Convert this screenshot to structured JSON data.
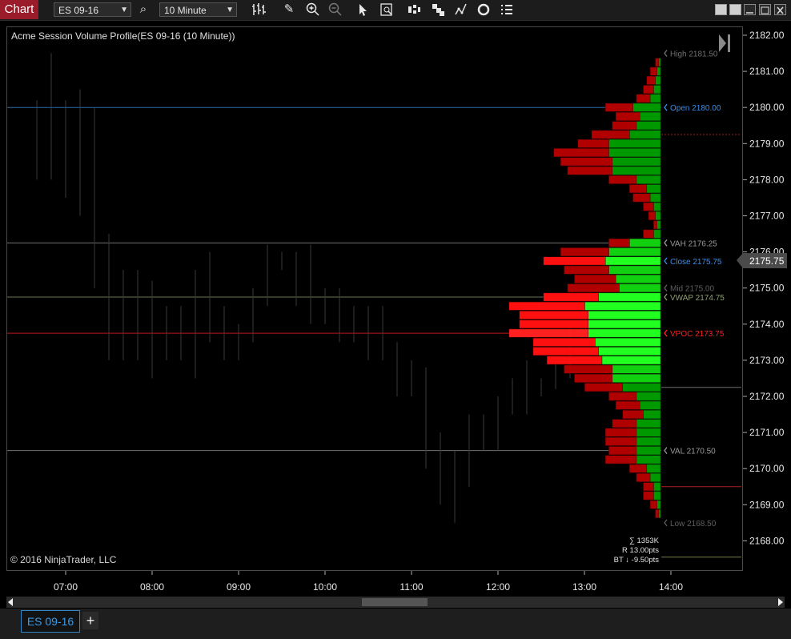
{
  "toolbar": {
    "chart_label": "Chart",
    "instrument": "ES 09-16",
    "interval": "10 Minute"
  },
  "chart": {
    "title": "Acme Session Volume Profile(ES 09-16 (10 Minute))",
    "copyright": "© 2016 NinjaTrader, LLC",
    "stats": [
      "∑ 1353K",
      "R 13.00pts",
      "BT ↓ -9.50pts"
    ],
    "current_price": "2175.75",
    "colors": {
      "bid": "#c00000",
      "ask": "#00c000",
      "poc": "#ff2020",
      "open": "#3a8ee6",
      "accent": "#9a1b2a"
    }
  },
  "chart_data": {
    "type": "volume-profile",
    "y_ticks": [
      "2182.00",
      "2181.00",
      "2180.00",
      "2179.00",
      "2178.00",
      "2177.00",
      "2176.00",
      "2175.00",
      "2174.00",
      "2173.00",
      "2172.00",
      "2171.00",
      "2170.00",
      "2169.00",
      "2168.00"
    ],
    "x_ticks": [
      "07:00",
      "08:00",
      "09:00",
      "10:00",
      "11:00",
      "12:00",
      "13:00",
      "14:00"
    ],
    "ylim": [
      2167.5,
      2182.3
    ],
    "levels": [
      {
        "label": "High 2181.50",
        "price": 2181.5,
        "color": "#6f6f6f"
      },
      {
        "label": "Open 2180.00",
        "price": 2180.0,
        "color": "#3a8ee6"
      },
      {
        "label": "VAH 2176.25",
        "price": 2176.25,
        "color": "#9a9a9a"
      },
      {
        "label": "Close 2175.75",
        "price": 2175.75,
        "color": "#3a8ee6"
      },
      {
        "label": "Mid 2175.00",
        "price": 2175.0,
        "color": "#5f5f5f"
      },
      {
        "label": "VWAP 2174.75",
        "price": 2174.75,
        "color": "#8f9f6f"
      },
      {
        "label": "VPOC 2173.75",
        "price": 2173.75,
        "color": "#ff2020"
      },
      {
        "label": "VAL 2170.50",
        "price": 2170.5,
        "color": "#9a9a9a"
      },
      {
        "label": "Low 2168.50",
        "price": 2168.5,
        "color": "#5f5f5f"
      }
    ],
    "profile": [
      {
        "price": 2181.25,
        "bid": 2,
        "ask": 1
      },
      {
        "price": 2181.0,
        "bid": 4,
        "ask": 2
      },
      {
        "price": 2180.75,
        "bid": 5,
        "ask": 3
      },
      {
        "price": 2180.5,
        "bid": 6,
        "ask": 4
      },
      {
        "price": 2180.25,
        "bid": 8,
        "ask": 6
      },
      {
        "price": 2180.0,
        "bid": 16,
        "ask": 16
      },
      {
        "price": 2179.75,
        "bid": 14,
        "ask": 12
      },
      {
        "price": 2179.5,
        "bid": 14,
        "ask": 14
      },
      {
        "price": 2179.25,
        "bid": 22,
        "ask": 18
      },
      {
        "price": 2179.0,
        "bid": 18,
        "ask": 30
      },
      {
        "price": 2178.75,
        "bid": 32,
        "ask": 30
      },
      {
        "price": 2178.5,
        "bid": 30,
        "ask": 28
      },
      {
        "price": 2178.25,
        "bid": 26,
        "ask": 28
      },
      {
        "price": 2178.0,
        "bid": 16,
        "ask": 14
      },
      {
        "price": 2177.75,
        "bid": 10,
        "ask": 8
      },
      {
        "price": 2177.5,
        "bid": 10,
        "ask": 6
      },
      {
        "price": 2177.25,
        "bid": 6,
        "ask": 4
      },
      {
        "price": 2177.0,
        "bid": 4,
        "ask": 3
      },
      {
        "price": 2176.75,
        "bid": 2,
        "ask": 2
      },
      {
        "price": 2176.5,
        "bid": 6,
        "ask": 4
      },
      {
        "price": 2176.25,
        "bid": 12,
        "ask": 18
      },
      {
        "price": 2176.0,
        "bid": 28,
        "ask": 30
      },
      {
        "price": 2175.75,
        "bid": 36,
        "ask": 32
      },
      {
        "price": 2175.5,
        "bid": 26,
        "ask": 30
      },
      {
        "price": 2175.25,
        "bid": 24,
        "ask": 26
      },
      {
        "price": 2175.0,
        "bid": 30,
        "ask": 24
      },
      {
        "price": 2174.75,
        "bid": 32,
        "ask": 36
      },
      {
        "price": 2174.5,
        "bid": 44,
        "ask": 44
      },
      {
        "price": 2174.25,
        "bid": 40,
        "ask": 42
      },
      {
        "price": 2174.0,
        "bid": 40,
        "ask": 42
      },
      {
        "price": 2173.75,
        "bid": 46,
        "ask": 42
      },
      {
        "price": 2173.5,
        "bid": 36,
        "ask": 38
      },
      {
        "price": 2173.25,
        "bid": 38,
        "ask": 36
      },
      {
        "price": 2173.0,
        "bid": 32,
        "ask": 34
      },
      {
        "price": 2172.75,
        "bid": 28,
        "ask": 28
      },
      {
        "price": 2172.5,
        "bid": 22,
        "ask": 28
      },
      {
        "price": 2172.25,
        "bid": 22,
        "ask": 22
      },
      {
        "price": 2172.0,
        "bid": 16,
        "ask": 14
      },
      {
        "price": 2171.75,
        "bid": 14,
        "ask": 12
      },
      {
        "price": 2171.5,
        "bid": 12,
        "ask": 10
      },
      {
        "price": 2171.25,
        "bid": 14,
        "ask": 14
      },
      {
        "price": 2171.0,
        "bid": 18,
        "ask": 14
      },
      {
        "price": 2170.75,
        "bid": 18,
        "ask": 14
      },
      {
        "price": 2170.5,
        "bid": 16,
        "ask": 14
      },
      {
        "price": 2170.25,
        "bid": 18,
        "ask": 14
      },
      {
        "price": 2170.0,
        "bid": 10,
        "ask": 8
      },
      {
        "price": 2169.75,
        "bid": 8,
        "ask": 6
      },
      {
        "price": 2169.5,
        "bid": 6,
        "ask": 4
      },
      {
        "price": 2169.25,
        "bid": 6,
        "ask": 4
      },
      {
        "price": 2169.0,
        "bid": 4,
        "ask": 2
      },
      {
        "price": 2168.75,
        "bid": 2,
        "ask": 1
      }
    ],
    "ohlc": [
      {
        "time": "06:40",
        "high": 2180.2,
        "low": 2178.0
      },
      {
        "time": "06:50",
        "high": 2181.5,
        "low": 2178.0
      },
      {
        "time": "07:00",
        "high": 2180.2,
        "low": 2177.5
      },
      {
        "time": "07:10",
        "high": 2180.5,
        "low": 2177.0
      },
      {
        "time": "07:20",
        "high": 2180.0,
        "low": 2175.0
      },
      {
        "time": "07:30",
        "high": 2176.5,
        "low": 2173.0
      },
      {
        "time": "07:40",
        "high": 2175.5,
        "low": 2173.0
      },
      {
        "time": "07:50",
        "high": 2175.5,
        "low": 2173.0
      },
      {
        "time": "08:00",
        "high": 2175.2,
        "low": 2172.5
      },
      {
        "time": "08:10",
        "high": 2174.5,
        "low": 2173.0
      },
      {
        "time": "08:20",
        "high": 2174.5,
        "low": 2173.0
      },
      {
        "time": "08:30",
        "high": 2175.5,
        "low": 2172.5
      },
      {
        "time": "08:40",
        "high": 2176.0,
        "low": 2173.5
      },
      {
        "time": "08:50",
        "high": 2174.5,
        "low": 2173.0
      },
      {
        "time": "09:00",
        "high": 2174.0,
        "low": 2173.0
      },
      {
        "time": "09:10",
        "high": 2175.0,
        "low": 2173.5
      },
      {
        "time": "09:20",
        "high": 2176.2,
        "low": 2174.5
      },
      {
        "time": "09:30",
        "high": 2176.0,
        "low": 2175.5
      },
      {
        "time": "09:40",
        "high": 2176.0,
        "low": 2174.5
      },
      {
        "time": "09:50",
        "high": 2176.2,
        "low": 2174.0
      },
      {
        "time": "10:00",
        "high": 2175.0,
        "low": 2174.0
      },
      {
        "time": "10:10",
        "high": 2175.0,
        "low": 2173.5
      },
      {
        "time": "10:20",
        "high": 2174.5,
        "low": 2173.5
      },
      {
        "time": "10:30",
        "high": 2174.5,
        "low": 2173.0
      },
      {
        "time": "10:40",
        "high": 2174.5,
        "low": 2173.0
      },
      {
        "time": "10:50",
        "high": 2173.5,
        "low": 2172.0
      },
      {
        "time": "11:00",
        "high": 2173.0,
        "low": 2172.0
      },
      {
        "time": "11:10",
        "high": 2172.8,
        "low": 2170.0
      },
      {
        "time": "11:20",
        "high": 2171.0,
        "low": 2169.0
      },
      {
        "time": "11:30",
        "high": 2170.5,
        "low": 2168.5
      },
      {
        "time": "11:40",
        "high": 2171.5,
        "low": 2169.5
      },
      {
        "time": "11:50",
        "high": 2171.5,
        "low": 2170.5
      },
      {
        "time": "12:00",
        "high": 2172.0,
        "low": 2170.5
      },
      {
        "time": "12:10",
        "high": 2172.5,
        "low": 2171.5
      },
      {
        "time": "12:20",
        "high": 2173.0,
        "low": 2171.5
      },
      {
        "time": "12:30",
        "high": 2172.5,
        "low": 2172.0
      },
      {
        "time": "12:40",
        "high": 2173.0,
        "low": 2172.2
      },
      {
        "time": "12:50",
        "high": 2174.0,
        "low": 2172.5
      }
    ]
  }
}
